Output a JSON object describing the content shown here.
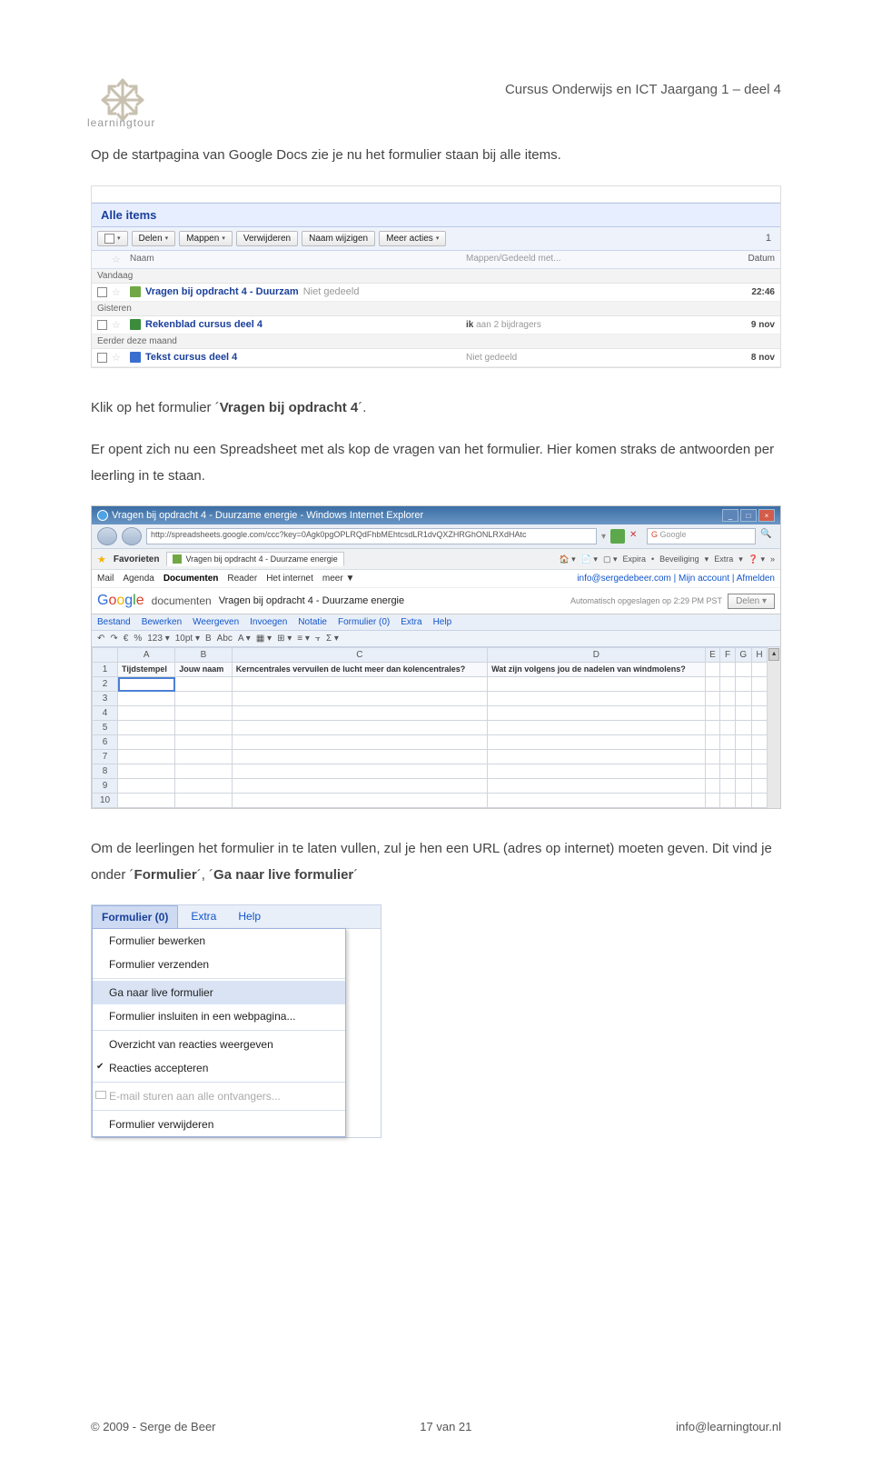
{
  "header": {
    "logo_text_1": "learning",
    "logo_text_2": "tour",
    "title": "Cursus Onderwijs en ICT Jaargang 1 – deel 4"
  },
  "para1": "Op de startpagina van Google Docs zie je nu het formulier staan bij alle items.",
  "shot1": {
    "title": "Alle items",
    "btns": [
      "Delen",
      "Mappen",
      "Verwijderen",
      "Naam wijzigen",
      "Meer acties"
    ],
    "col_name": "Naam",
    "col_share": "Mappen/Gedeeld met...",
    "col_date": "Datum",
    "grp1": "Vandaag",
    "row1_name": "Vragen bij opdracht 4 - Duurzam",
    "row1_share": "Niet gedeeld",
    "row1_date": "22:46",
    "grp2": "Gisteren",
    "row2_name": "Rekenblad cursus deel 4",
    "row2_share_pre": "ik",
    "row2_share": " aan 2 bijdragers",
    "row2_date": "9 nov",
    "grp3": "Eerder deze maand",
    "row3_name": "Tekst cursus deel 4",
    "row3_share": "Niet gedeeld",
    "row3_date": "8 nov"
  },
  "para2a": "Klik op het formulier ´",
  "para2b": "Vragen bij opdracht 4",
  "para2c": "´.",
  "para3": "Er opent zich nu een Spreadsheet met als kop de vragen van het formulier. Hier komen straks de antwoorden per leerling in te staan.",
  "shot2": {
    "ie_title": "Vragen bij opdracht 4 - Duurzame energie - Windows Internet Explorer",
    "url": "http://spreadsheets.google.com/ccc?key=0Agk0pgOPLRQdFhbMEhtcsdLR1dvQXZHRGhONLRXdHAtc",
    "search_ph": "Google",
    "fav_label": "Favorieten",
    "tab_label": "Vragen bij opdracht 4 - Duurzame energie",
    "rt_items": [
      "Expira",
      "Beveiliging",
      "Extra"
    ],
    "gbar": [
      "Mail",
      "Agenda",
      "Documenten",
      "Reader",
      "Het internet",
      "meer ▼"
    ],
    "gbar_right": "info@sergedebeer.com | Mijn account | Afmelden",
    "docs_word": "documenten",
    "doc_title": "Vragen bij opdracht 4 - Duurzame energie",
    "save_note": "Automatisch opgeslagen op 2:29 PM PST",
    "delen": "Delen ▾",
    "menus": [
      "Bestand",
      "Bewerken",
      "Weergeven",
      "Invoegen",
      "Notatie",
      "Formulier (0)",
      "Extra",
      "Help"
    ],
    "tool_items": [
      "↶",
      "↷",
      "€",
      "%",
      "123 ▾",
      "10pt ▾",
      "B",
      "Abc",
      "A ▾",
      "▦ ▾",
      "⊞ ▾",
      "≡ ▾",
      "⫟",
      "Σ ▾"
    ],
    "cols": [
      "A",
      "B",
      "C",
      "D",
      "E",
      "F",
      "G",
      "H"
    ],
    "headers": [
      "Tijdstempel",
      "Jouw naam",
      "Kerncentrales vervuilen de lucht meer dan kolencentrales?",
      "Wat zijn volgens jou de nadelen van windmolens?"
    ]
  },
  "para4a": "Om de leerlingen het formulier in te laten vullen, zul je hen een URL (adres op internet) moeten geven. Dit vind je onder ´",
  "para4b": "Formulier",
  "para4c": "´, ´",
  "para4d": "Ga naar live formulier",
  "para4e": "´",
  "shot3": {
    "menus": [
      "Formulier (0)",
      "Extra",
      "Help"
    ],
    "items": [
      "Formulier bewerken",
      "Formulier verzenden",
      "Ga naar live formulier",
      "Formulier insluiten in een webpagina...",
      "Overzicht van reacties weergeven",
      "Reacties accepteren",
      "E-mail sturen aan alle ontvangers...",
      "Formulier verwijderen"
    ]
  },
  "footer": {
    "left": "© 2009 - Serge de Beer",
    "mid": "17 van 21",
    "right": "info@learningtour.nl"
  }
}
